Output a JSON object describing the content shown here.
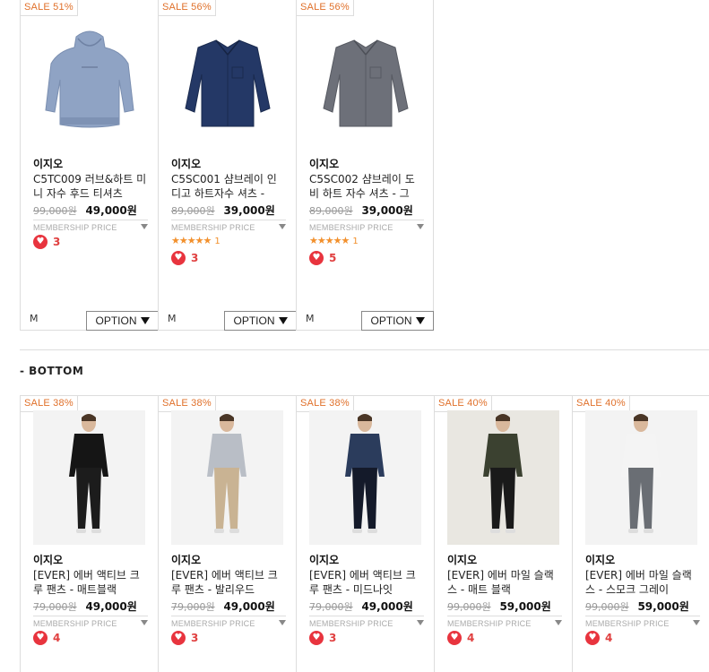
{
  "top_products": [
    {
      "sale": "SALE 51%",
      "brand": "이지오",
      "name": "C5TC009 러브&하트 미니 자수 후드 티셔츠",
      "orig": "99,000원",
      "price": "49,000원",
      "member": "MEMBERSHIP PRICE",
      "stars": "",
      "rating_count": "",
      "likes": "3",
      "size": "M",
      "option": "OPTION",
      "img": "hoodie",
      "color": "#8fa3c4"
    },
    {
      "sale": "SALE 56%",
      "brand": "이지오",
      "name": "C5SC001 샴브레이 인디고 하트자수 셔츠 -",
      "orig": "89,000원",
      "price": "39,000원",
      "member": "MEMBERSHIP PRICE",
      "stars": "★★★★★",
      "rating_count": "1",
      "likes": "3",
      "size": "M",
      "option": "OPTION",
      "img": "shirt",
      "color": "#243866"
    },
    {
      "sale": "SALE 56%",
      "brand": "이지오",
      "name": "C5SC002 샴브레이 도비 하트 자수 셔츠 - 그",
      "orig": "89,000원",
      "price": "39,000원",
      "member": "MEMBERSHIP PRICE",
      "stars": "★★★★★",
      "rating_count": "1",
      "likes": "5",
      "size": "M",
      "option": "OPTION",
      "img": "shirt",
      "color": "#6d7079"
    }
  ],
  "section": {
    "title": "- BOTTOM"
  },
  "bottom_products": [
    {
      "sale": "SALE 38%",
      "brand": "이지오",
      "name": "[EVER] 에버 액티브 크루 팬츠 - 매트블랙",
      "orig": "79,000원",
      "price": "49,000원",
      "member": "MEMBERSHIP PRICE",
      "likes": "4",
      "top": "#151515",
      "pants": "#1c1c1c"
    },
    {
      "sale": "SALE 38%",
      "brand": "이지오",
      "name": "[EVER] 에버 액티브 크루 팬츠 - 발리우드",
      "orig": "79,000원",
      "price": "49,000원",
      "member": "MEMBERSHIP PRICE",
      "likes": "3",
      "top": "#b9bec6",
      "pants": "#c9b393"
    },
    {
      "sale": "SALE 38%",
      "brand": "이지오",
      "name": "[EVER] 에버 액티브 크루 팬츠 - 미드나잇",
      "orig": "79,000원",
      "price": "49,000원",
      "member": "MEMBERSHIP PRICE",
      "likes": "3",
      "top": "#2b3c5c",
      "pants": "#141a2a"
    },
    {
      "sale": "SALE 40%",
      "brand": "이지오",
      "name": "[EVER] 에버 마일 슬랙스 - 매트 블랙",
      "orig": "99,000원",
      "price": "59,000원",
      "member": "MEMBERSHIP PRICE",
      "likes": "4",
      "top": "#3b4130",
      "pants": "#1a1a1a"
    },
    {
      "sale": "SALE 40%",
      "brand": "이지오",
      "name": "[EVER] 에버 마일 슬랙스 - 스모크 그레이",
      "orig": "99,000원",
      "price": "59,000원",
      "member": "MEMBERSHIP PRICE",
      "likes": "4",
      "top": "#f4f4f4",
      "pants": "#6a6e74"
    }
  ],
  "colors": {
    "sale": "#e0702a",
    "heart": "#e8343e",
    "likes": "#e04040",
    "star": "#f2902c"
  }
}
